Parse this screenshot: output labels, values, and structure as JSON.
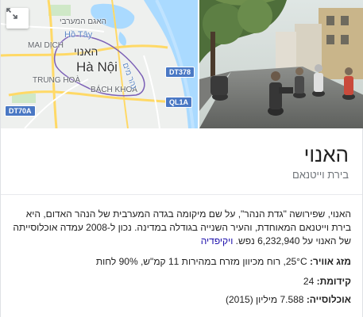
{
  "map": {
    "city_he": "האנוי",
    "city_vi": "Hà Nội",
    "lake_he": "האגם המערבי",
    "lake_vi": "Hồ Tây",
    "district_1": "MAI DỊCH",
    "district_2": "TRUNG HOÀ",
    "district_3": "BÁCH KHOA",
    "river_he": "נהר מים",
    "roads": {
      "dt378": "DT378",
      "ql1a": "QL1A",
      "dt70a": "DT70A"
    },
    "colors": {
      "boundary": "#7b5fb6",
      "water": "#aadaff",
      "road": "#ffd966",
      "badge": "#4a78c4"
    }
  },
  "photo": {
    "icon": "street-photo-image"
  },
  "entity": {
    "title": "האנוי",
    "subtitle": "בירת וייטנאם"
  },
  "description": {
    "text": "האנוי, שפירושה \"גדת הנהר\", על שם מיקומה בגדה המערבית של הנהר האדום, היא בירת וייטנאם המאוחדת, והעיר השנייה בגודלה במדינה. נכון ל-2008 עמדה אוכלוסייתה של האנוי על 6,232,940 נפש.",
    "source_link": "ויקיפדיה"
  },
  "facts": [
    {
      "key": "מזג אוויר:",
      "value": "25°C, רוח מכיוון מזרח במהירות 11 קמ\"ש, 90% לחות"
    },
    {
      "key": "קידומת:",
      "value": "24"
    },
    {
      "key": "אוכלוסייה:",
      "value": "7.588 מיליון (2015)"
    }
  ]
}
